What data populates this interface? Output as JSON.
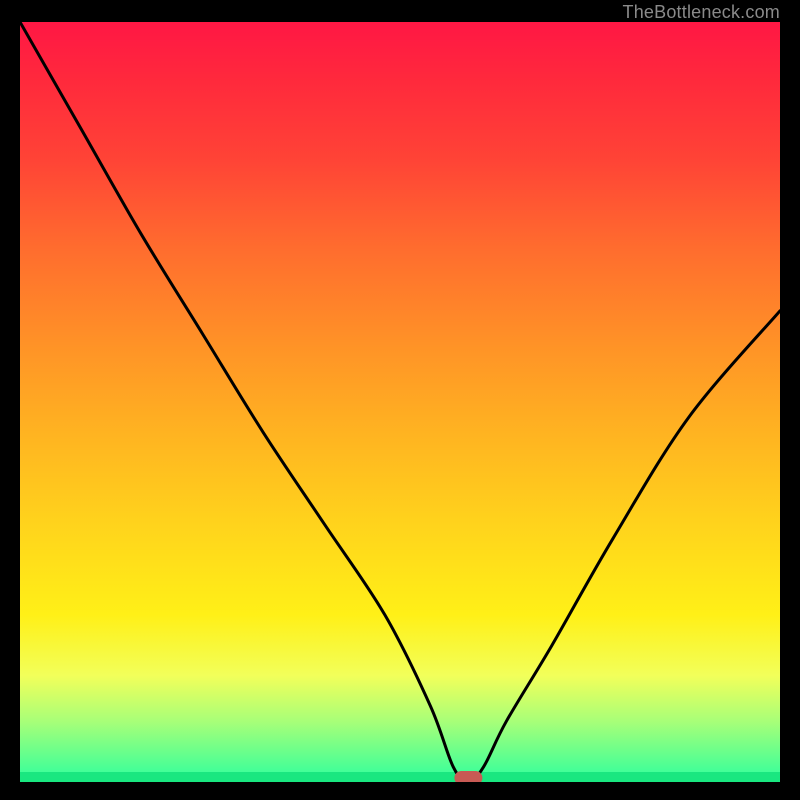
{
  "watermark": "TheBottleneck.com",
  "colors": {
    "frame": "#000000",
    "gradient_top": "#ff1744",
    "gradient_mid": "#ffd31c",
    "gradient_bottom": "#2eff9e",
    "curve": "#000000",
    "marker": "#c85a54"
  },
  "chart_data": {
    "type": "line",
    "title": "",
    "xlabel": "",
    "ylabel": "",
    "xlim": [
      0,
      100
    ],
    "ylim": [
      0,
      100
    ],
    "axes_visible": false,
    "grid": false,
    "background": "vertical-gradient red→yellow→green",
    "series": [
      {
        "name": "bottleneck-curve",
        "description": "V-shaped curve; minimum near x≈58",
        "x": [
          0,
          8,
          16,
          24,
          32,
          40,
          48,
          54,
          57,
          59,
          61,
          64,
          70,
          78,
          88,
          100
        ],
        "values": [
          100,
          86,
          72,
          59,
          46,
          34,
          22,
          10,
          2,
          0,
          2,
          8,
          18,
          32,
          48,
          62
        ]
      }
    ],
    "minimum": {
      "x": 59,
      "y": 0
    },
    "annotations": []
  }
}
